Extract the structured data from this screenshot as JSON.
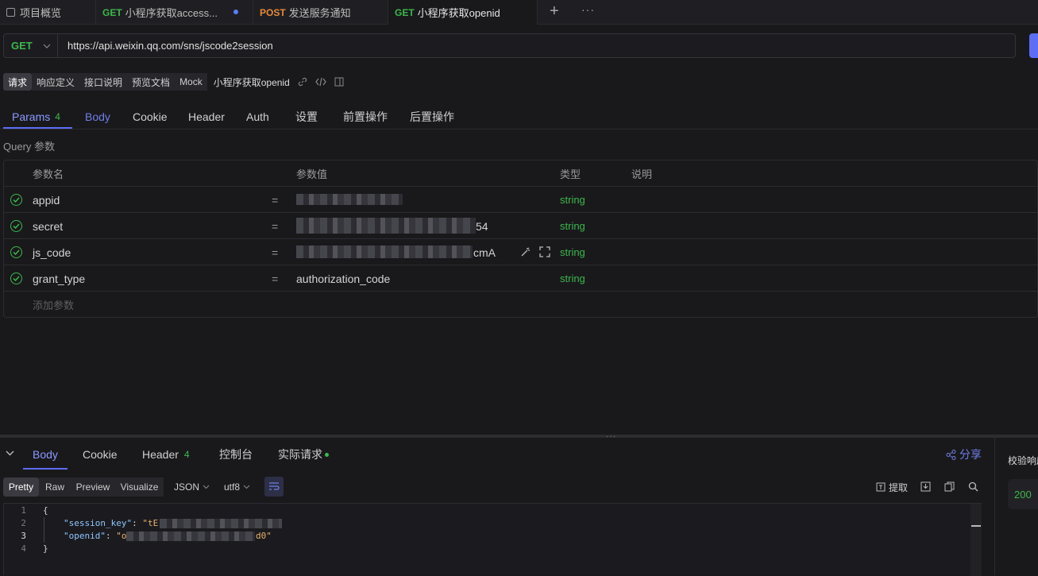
{
  "tabs": [
    {
      "method": "",
      "label": "项目概览"
    },
    {
      "method": "GET",
      "label": "小程序获取access..."
    },
    {
      "method": "POST",
      "label": "发送服务通知"
    },
    {
      "method": "GET",
      "label": "小程序获取openid"
    }
  ],
  "tab_actions": {
    "add": "+",
    "more": "···"
  },
  "request": {
    "method": "GET",
    "url": "https://api.weixin.qq.com/sns/jscode2session"
  },
  "subnav": {
    "items": [
      "请求",
      "响应定义",
      "接口说明",
      "预览文档",
      "Mock"
    ],
    "api_name": "小程序获取openid"
  },
  "param_tabs": {
    "params_label": "Params",
    "params_count": "4",
    "items": [
      "Body",
      "Cookie",
      "Header",
      "Auth",
      "设置",
      "前置操作",
      "后置操作"
    ]
  },
  "query": {
    "section_title": "Query 参数",
    "headers": [
      "参数名",
      "参数值",
      "类型",
      "说明"
    ],
    "rows": [
      {
        "name": "appid",
        "eq": "=",
        "value_tail": "",
        "type": "string"
      },
      {
        "name": "secret",
        "eq": "=",
        "value_tail": "54",
        "type": "string"
      },
      {
        "name": "js_code",
        "eq": "=",
        "value_tail": "cmA",
        "type": "string"
      },
      {
        "name": "grant_type",
        "eq": "=",
        "value": "authorization_code",
        "type": "string"
      }
    ],
    "add_placeholder": "添加参数"
  },
  "response": {
    "tabs": [
      "Body",
      "Cookie",
      "Header",
      "控制台",
      "实际请求"
    ],
    "header_count": "4",
    "share": "分享",
    "formats": [
      "Pretty",
      "Raw",
      "Preview",
      "Visualize"
    ],
    "json_select": "JSON",
    "charset_select": "utf8",
    "extract": "提取",
    "code": {
      "lines": [
        "1",
        "2",
        "3",
        "4"
      ],
      "open": "{",
      "key1": "\"session_key\"",
      "val1_start": "\"tE",
      "key2": "\"openid\"",
      "val2_start": "\"o",
      "val2_end": "d0\"",
      "close": "}"
    },
    "side": {
      "label": "校验响应",
      "status": "200"
    }
  },
  "colors": {
    "get": "#3cb84b",
    "post": "#e8893c",
    "accent": "#5b6ef5",
    "string_type": "#3cb84b"
  }
}
